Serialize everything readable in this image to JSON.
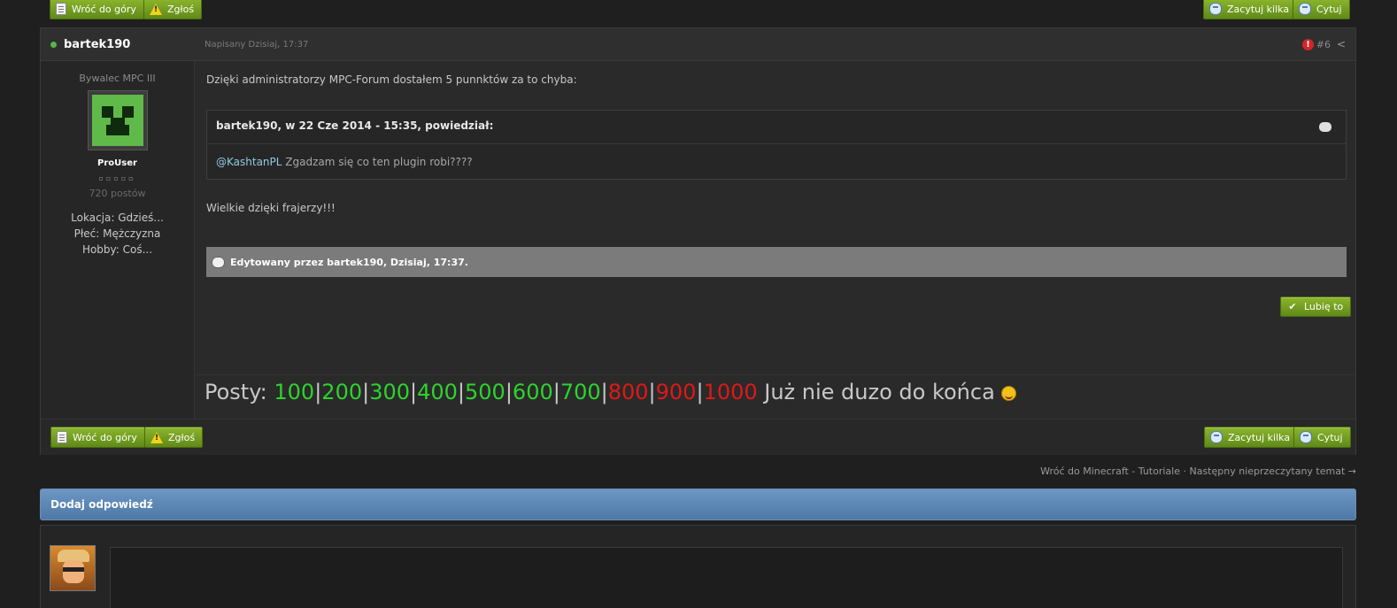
{
  "top_bar": {
    "back_to_top": "Wróć do góry",
    "report": "Zgłoś",
    "multiquote": "Zacytuj kilka",
    "quote": "Cytuj"
  },
  "post": {
    "author": "bartek190",
    "posted": "Napisany Dzisiaj, 17:37",
    "post_number": "#6",
    "sidebar": {
      "rank_title": "Bywalec MPC III",
      "group": "ProUser",
      "pips": "▫▫▫▫▫",
      "post_count": "720 postów",
      "location": "Lokacja: Gdzieś...",
      "gender": "Płeć: Mężczyzna",
      "hobby": "Hobby: Coś..."
    },
    "text1": "Dzięki administratorzy MPC-Forum dostałem 5 punnktów za to chyba:",
    "quote": {
      "header": "bartek190, w 22 Cze 2014 - 15:35, powiedział:",
      "mention": "@KashtanPL",
      "body": " Zgadzam się co ten plugin robi????"
    },
    "text2": "Wielkie dzięki frajerzy!!!",
    "edited": "Edytowany przez bartek190, Dzisiaj, 17:37.",
    "like_label": "Lubię to",
    "signature": {
      "prefix": "Posty: ",
      "green": [
        "100",
        "200",
        "300",
        "400",
        "500",
        "600",
        "700"
      ],
      "red": [
        "800",
        "900",
        "1000"
      ],
      "sep": "|",
      "suffix": " Już nie duzo do końca"
    }
  },
  "bottom_bar": {
    "back_to_top": "Wróć do góry",
    "report": "Zgłoś",
    "multiquote": "Zacytuj kilka",
    "quote": "Cytuj"
  },
  "nav": {
    "back_link": "Wróć do Minecraft - Tutoriale",
    "separator": " · ",
    "next_link": "Następny nieprzeczytany temat →"
  },
  "reply": {
    "title": "Dodaj odpowiedź"
  },
  "colors": {
    "button_green": "#6f9d1f",
    "reply_header_blue": "#5a85b2",
    "sig_green": "#2dd32d",
    "sig_red": "#e01818"
  }
}
